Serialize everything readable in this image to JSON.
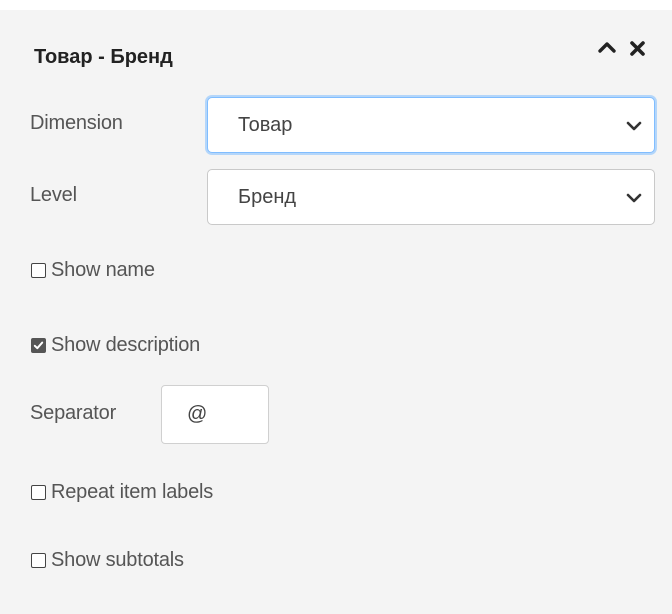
{
  "panel": {
    "title": "Товар - Бренд",
    "collapse_icon": "chevron-up-icon",
    "close_icon": "close-icon"
  },
  "dimension": {
    "label": "Dimension",
    "value": "Товар"
  },
  "level": {
    "label": "Level",
    "value": "Бренд"
  },
  "options": {
    "show_name": {
      "label": "Show name",
      "checked": false
    },
    "show_description": {
      "label": "Show description",
      "checked": true
    },
    "repeat_item_labels": {
      "label": "Repeat item labels",
      "checked": false
    },
    "show_subtotals": {
      "label": "Show subtotals",
      "checked": false
    }
  },
  "separator": {
    "label": "Separator",
    "value": "@"
  },
  "colors": {
    "focus": "#80bdff",
    "text": "#555555",
    "background": "#f4f4f4"
  }
}
